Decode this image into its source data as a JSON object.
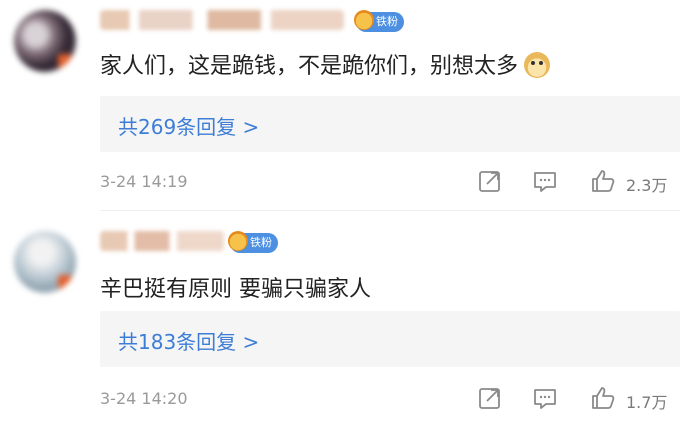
{
  "comments": [
    {
      "badge": "铁粉",
      "text": "家人们，这是跪钱，不是跪你们，别想太多",
      "emoji_icon": "doge-icon",
      "replies_link": "共269条回复 >",
      "timestamp": "3-24 14:19",
      "likes": "2.3万"
    },
    {
      "badge": "铁粉",
      "text": "辛巴挺有原则 要骗只骗家人",
      "replies_link": "共183条回复 >",
      "timestamp": "3-24 14:20",
      "likes": "1.7万"
    }
  ],
  "colors": {
    "link": "#3d7dd6",
    "badge": "#4d8fe0",
    "meta": "#9a9a9a",
    "reply_bg": "#f5f5f5"
  }
}
